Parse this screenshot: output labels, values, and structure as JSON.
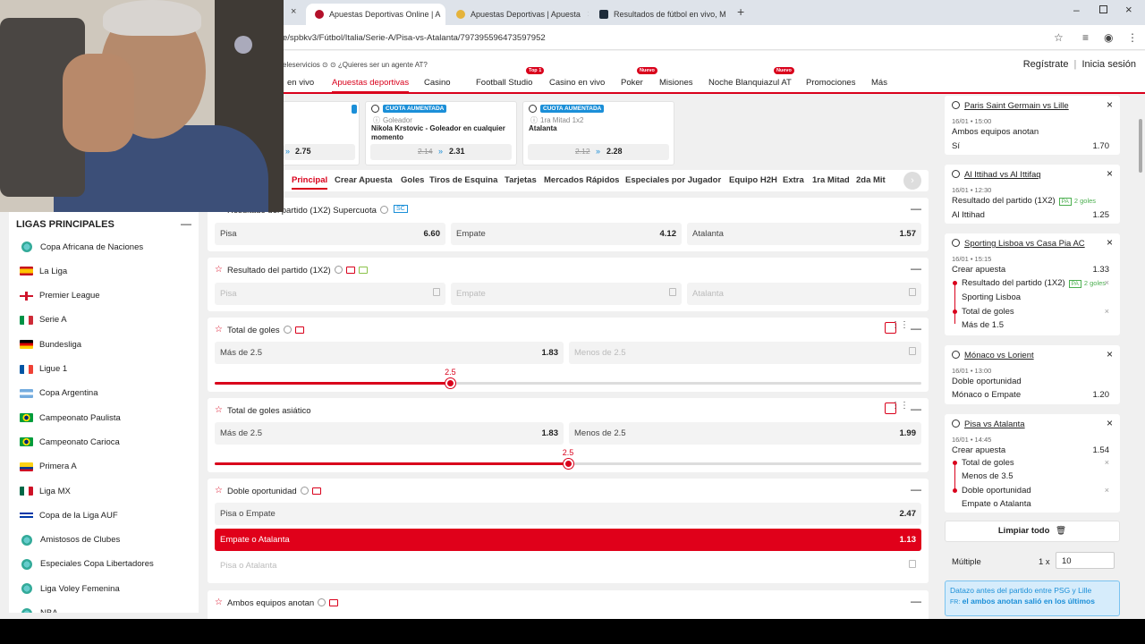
{
  "browser": {
    "tabs": [
      {
        "title": "Apuestas Deportivas Online | A",
        "active": true
      },
      {
        "title": "Apuestas Deportivas | Apuesta",
        "active": false
      },
      {
        "title": "Resultados de fútbol en vivo, M",
        "active": false
      }
    ],
    "url": "e/spbkv3/Fútbol/Italia/Serie-A/Pisa-vs-Atalanta/797395596473597952"
  },
  "site": {
    "top_links": "eleservicios  ⊙ ⊙  ¿Quieres ser un agente AT?",
    "register": "Regístrate",
    "login": "Inicia sesión",
    "nav": [
      {
        "label": "en vivo",
        "badge": ""
      },
      {
        "label": "Apuestas deportivas",
        "badge": ""
      },
      {
        "label": "Casino",
        "badge": ""
      },
      {
        "label": "Football Studio",
        "badge": "Top 1"
      },
      {
        "label": "Casino en vivo",
        "badge": ""
      },
      {
        "label": "Poker",
        "badge": "Nuevo"
      },
      {
        "label": "Misiones",
        "badge": ""
      },
      {
        "label": "Noche Blanquiazul AT",
        "badge": "Nuevo"
      },
      {
        "label": "Promociones",
        "badge": ""
      },
      {
        "label": "Más",
        "badge": ""
      }
    ]
  },
  "leagues": {
    "title": "LIGAS PRINCIPALES",
    "items": [
      {
        "label": "Copa Africana de Naciones",
        "icon": "globe-icon"
      },
      {
        "label": "La Liga",
        "icon": "flag-spain"
      },
      {
        "label": "Premier League",
        "icon": "flag-england"
      },
      {
        "label": "Serie A",
        "icon": "flag-italy"
      },
      {
        "label": "Bundesliga",
        "icon": "flag-germany"
      },
      {
        "label": "Ligue 1",
        "icon": "flag-france"
      },
      {
        "label": "Copa Argentina",
        "icon": "flag-argentina"
      },
      {
        "label": "Campeonato Paulista",
        "icon": "flag-brazil"
      },
      {
        "label": "Campeonato Carioca",
        "icon": "flag-brazil"
      },
      {
        "label": "Primera A",
        "icon": "flag-colombia"
      },
      {
        "label": "Liga MX",
        "icon": "flag-mexico"
      },
      {
        "label": "Copa de la Liga AUF",
        "icon": "flag-uruguay"
      },
      {
        "label": "Amistosos de Clubes",
        "icon": "globe-icon"
      },
      {
        "label": "Especiales Copa Libertadores",
        "icon": "globe-icon"
      },
      {
        "label": "Liga Voley Femenina",
        "icon": "globe-icon"
      },
      {
        "label": "NBA",
        "icon": "globe-icon"
      }
    ]
  },
  "promo_cards": [
    {
      "badge": "",
      "sub": "",
      "name": "",
      "old": "",
      "odd": "2.75"
    },
    {
      "badge": "CUOTA AUMENTADA",
      "sub": "Goleador",
      "name": "Nikola Krstovic - Goleador en cualquier momento",
      "old": "2.14",
      "odd": "2.31"
    },
    {
      "badge": "CUOTA AUMENTADA",
      "sub": "1ra Mitad 1x2",
      "name": "Atalanta",
      "old": "2.12",
      "odd": "2.28"
    }
  ],
  "subtabs": [
    "Principal",
    "Crear Apuesta",
    "Goles",
    "Tiros de Esquina",
    "Tarjetas",
    "Mercados Rápidos",
    "Especiales por Jugador",
    "Equipo H2H",
    "Extra",
    "1ra Mitad",
    "2da Mit"
  ],
  "markets": {
    "supercuota": {
      "title": "Resultado del partido (1X2) Supercuota",
      "tag": "SC",
      "sels": [
        {
          "name": "Pisa",
          "odd": "6.60"
        },
        {
          "name": "Empate",
          "odd": "4.12"
        },
        {
          "name": "Atalanta",
          "odd": "1.57"
        }
      ]
    },
    "result": {
      "title": "Resultado del partido (1X2)",
      "sels": [
        {
          "name": "Pisa"
        },
        {
          "name": "Empate"
        },
        {
          "name": "Atalanta"
        }
      ]
    },
    "total": {
      "title": "Total de goles",
      "over": {
        "name": "Más de 2.5",
        "odd": "1.83"
      },
      "under": {
        "name": "Menos de 2.5"
      },
      "line": "2.5",
      "line_value": 2.5,
      "line_min": 0.5,
      "line_max": 6.5
    },
    "asian": {
      "title": "Total de goles asiático",
      "over": {
        "name": "Más de 2.5",
        "odd": "1.83"
      },
      "under": {
        "name": "Menos de 2.5",
        "odd": "1.99"
      },
      "line": "2.5",
      "line_value": 2.5,
      "line_min": 0.5,
      "line_max": 4.5
    },
    "double": {
      "title": "Doble oportunidad",
      "sels": [
        {
          "name": "Pisa o Empate",
          "odd": "2.47"
        },
        {
          "name": "Empate o Atalanta",
          "odd": "1.13"
        },
        {
          "name": "Pisa o Atalanta",
          "odd": ""
        }
      ]
    },
    "btts": {
      "title": "Ambos equipos anotan"
    }
  },
  "betslip": {
    "bets": [
      {
        "event": "Paris Saint Germain vs Lille",
        "date": "16/01 • 15:00",
        "market": "Ambos equipos anotan",
        "pick": "Sí",
        "odd": "1.70"
      },
      {
        "event": "Al Ittihad vs Al Ittifaq",
        "date": "16/01 • 12:30",
        "market": "Resultado del partido (1X2)",
        "tag": "PA",
        "goals": "2 goles",
        "pick": "Al Ittihad",
        "odd": "1.25"
      },
      {
        "event": "Sporting Lisboa vs Casa Pia AC",
        "date": "16/01 • 15:15",
        "market": "Crear apuesta",
        "odd": "1.33",
        "legs": [
          {
            "market": "Resultado del partido (1X2)",
            "tag": "PA",
            "goals": "2 goles",
            "pick": "Sporting Lisboa"
          },
          {
            "market": "Total de goles",
            "pick": "Más de 1.5"
          }
        ]
      },
      {
        "event": "Mónaco vs Lorient",
        "date": "16/01 • 13:00",
        "market": "Doble oportunidad",
        "pick": "Mónaco o Empate",
        "odd": "1.20"
      },
      {
        "event": "Pisa vs Atalanta",
        "date": "16/01 • 14:45",
        "market": "Crear apuesta",
        "odd": "1.54",
        "legs": [
          {
            "market": "Total de goles",
            "pick": "Menos de 3.5"
          },
          {
            "market": "Doble oportunidad",
            "pick": "Empate o Atalanta"
          }
        ]
      }
    ],
    "clear_all": "Limpiar todo",
    "multiple_label": "Múltiple",
    "multiplier": "1 x",
    "stake": "10",
    "info_line1": "Datazo antes del partido entre PSG y Lille",
    "info_prefix": "FR:",
    "info_line2": "el ambos anotan salió en los últimos"
  },
  "colors": {
    "brand": "#d9001b",
    "accent_blue": "#1b8fd8"
  }
}
